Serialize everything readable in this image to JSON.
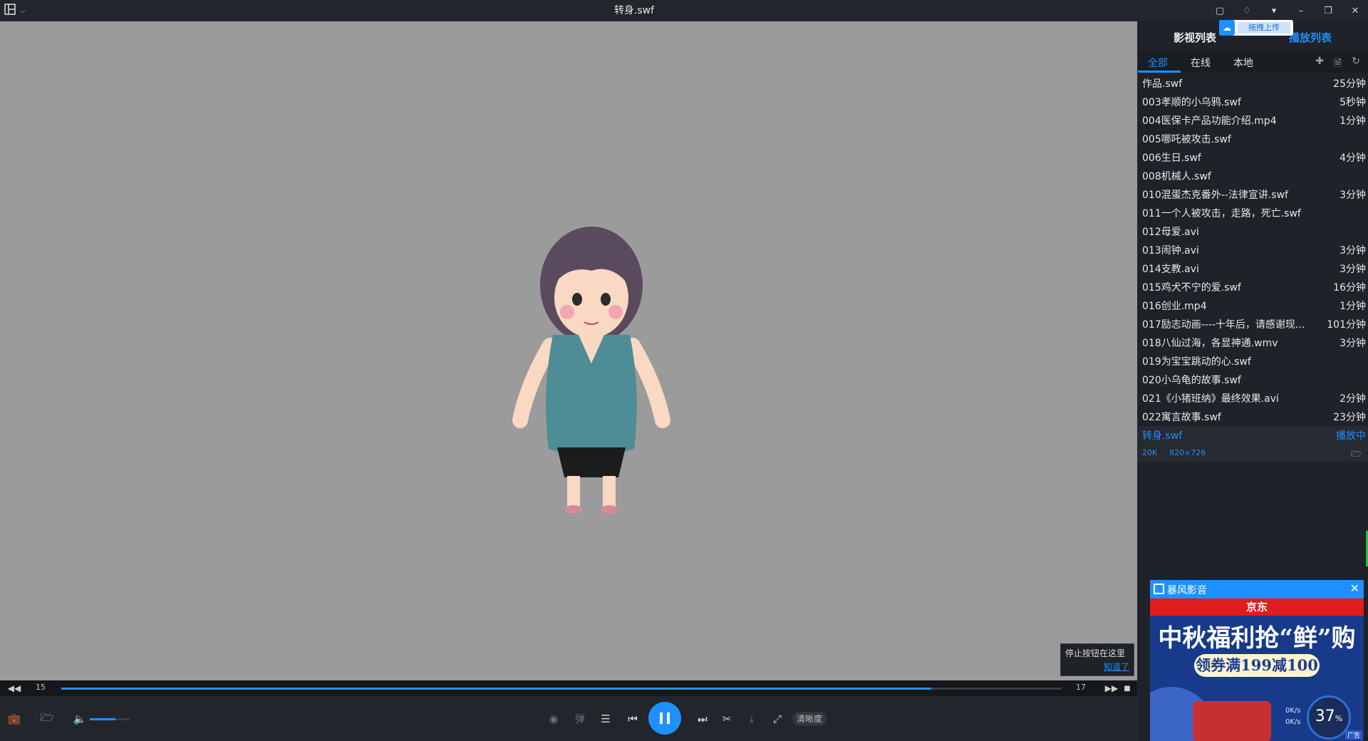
{
  "window": {
    "title": "转身.swf"
  },
  "titlebar": {
    "right_icons": [
      "message-icon",
      "bell-icon",
      "shirt-icon",
      "minimize-icon",
      "restore-icon",
      "close-icon"
    ]
  },
  "tip": {
    "text": "停止按钮在这里",
    "link": "知道了"
  },
  "progress": {
    "current": "15",
    "total": "17",
    "fraction": 0.87
  },
  "volume": {
    "level": 0.65
  },
  "controls": {
    "danmaku_label": "弹",
    "clarity_label": "清晰度"
  },
  "panel": {
    "title_left": "影视列表",
    "title_right": "播放列表",
    "cloud_upload": "拖拽上传",
    "tabs": [
      "全部",
      "在线",
      "本地"
    ],
    "items": [
      {
        "name": "作品.swf",
        "duration": "25分钟"
      },
      {
        "name": "003孝顺的小乌鸦.swf",
        "duration": "5秒钟"
      },
      {
        "name": "004医保卡产品功能介绍.mp4",
        "duration": "1分钟"
      },
      {
        "name": "005哪吒被攻击.swf",
        "duration": ""
      },
      {
        "name": "006生日.swf",
        "duration": "4分钟"
      },
      {
        "name": "008机械人.swf",
        "duration": ""
      },
      {
        "name": "010混蛋杰克番外--法律宣讲.swf",
        "duration": "3分钟"
      },
      {
        "name": "011一个人被攻击，走路，死亡.swf",
        "duration": ""
      },
      {
        "name": "012母爱.avi",
        "duration": ""
      },
      {
        "name": "013闹钟.avi",
        "duration": "3分钟"
      },
      {
        "name": "014支教.avi",
        "duration": "3分钟"
      },
      {
        "name": "015鸡犬不宁的爱.swf",
        "duration": "16分钟"
      },
      {
        "name": "016创业.mp4",
        "duration": "1分钟"
      },
      {
        "name": "017励志动画----十年后，请感谢现...",
        "duration": "101分钟"
      },
      {
        "name": "018八仙过海，各显神通.wmv",
        "duration": "3分钟"
      },
      {
        "name": "019为宝宝跳动的心.swf",
        "duration": ""
      },
      {
        "name": "020小乌龟的故事.swf",
        "duration": ""
      },
      {
        "name": "021《小猪班纳》最终效果.avi",
        "duration": "2分钟"
      },
      {
        "name": "022寓言故事.swf",
        "duration": "23分钟"
      }
    ],
    "current": {
      "name": "转身.swf",
      "status": "播放中",
      "size": "20K",
      "resolution": "820×726"
    }
  },
  "ad": {
    "brand": "暴风影音",
    "jd": "京东",
    "headline": "中秋福利抢“鲜”购",
    "coupon": "领券满199减100",
    "speed_up": "0K/s",
    "speed_down": "0K/s",
    "percent": "37",
    "tag": "广告"
  }
}
